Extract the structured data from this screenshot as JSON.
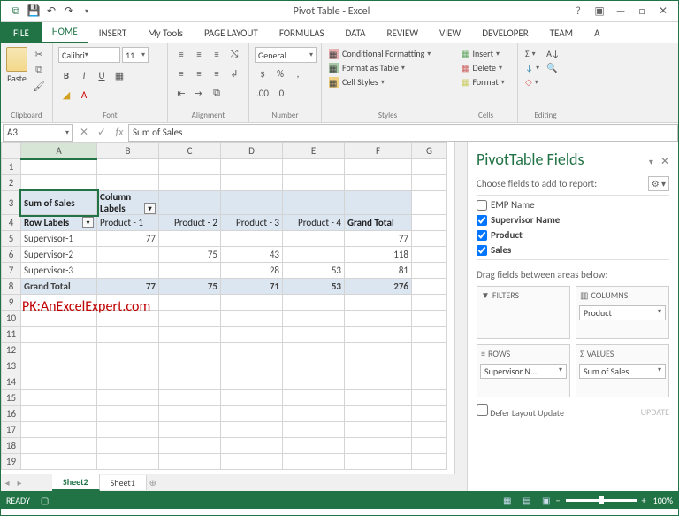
{
  "title": "Pivot Table - Excel",
  "tabs": {
    "file": "FILE",
    "home": "HOME",
    "insert": "INSERT",
    "mytools": "My Tools",
    "page": "PAGE LAYOUT",
    "formulas": "FORMULAS",
    "data": "DATA",
    "review": "REVIEW",
    "view": "VIEW",
    "developer": "DEVELOPER",
    "team": "TEAM",
    "a": "A"
  },
  "ribbon": {
    "paste": "Paste",
    "clipboard": "Clipboard",
    "font_name": "Calibri",
    "font_size": "11",
    "font_group": "Font",
    "alignment": "Alignment",
    "num_format": "General",
    "number_group": "Number",
    "cond_fmt": "Conditional Formatting",
    "fmt_table": "Format as Table",
    "cell_styles": "Cell Styles",
    "styles_group": "Styles",
    "insert": "Insert",
    "delete": "Delete",
    "format": "Format",
    "cells_group": "Cells",
    "editing_group": "Editing"
  },
  "formula": {
    "cell_ref": "A3",
    "fx": "fx",
    "value": "Sum of Sales"
  },
  "columns": [
    "A",
    "B",
    "C",
    "D",
    "E",
    "F",
    "G"
  ],
  "pivot": {
    "a3": "Sum of Sales",
    "b3": "Column Labels",
    "a4": "Row Labels",
    "b4": "Product - 1",
    "c4": "Product - 2",
    "d4": "Product - 3",
    "e4": "Product - 4",
    "f4": "Grand Total",
    "rows": [
      {
        "label": "Supervisor-1",
        "v": [
          "77",
          "",
          "",
          "",
          "77"
        ]
      },
      {
        "label": "Supervisor-2",
        "v": [
          "",
          "75",
          "43",
          "",
          "118"
        ]
      },
      {
        "label": "Supervisor-3",
        "v": [
          "",
          "",
          "28",
          "53",
          "81"
        ]
      }
    ],
    "grand": {
      "label": "Grand Total",
      "v": [
        "77",
        "75",
        "71",
        "53",
        "276"
      ]
    }
  },
  "watermark": "PK:AnExcelExpert.com",
  "sheet_tabs": {
    "s2": "Sheet2",
    "s1": "Sheet1"
  },
  "pane": {
    "title": "PivotTable Fields",
    "choose": "Choose fields to add to report:",
    "fields": [
      {
        "label": "EMP Name",
        "checked": false,
        "bold": false
      },
      {
        "label": "Supervisor Name",
        "checked": true,
        "bold": true
      },
      {
        "label": "Product",
        "checked": true,
        "bold": true
      },
      {
        "label": "Sales",
        "checked": true,
        "bold": true
      }
    ],
    "drag": "Drag fields between areas below:",
    "filters": "FILTERS",
    "columns": "COLUMNS",
    "rows": "ROWS",
    "values": "VALUES",
    "chip_product": "Product",
    "chip_super": "Supervisor N...",
    "chip_sum": "Sum of Sales",
    "defer": "Defer Layout Update",
    "update": "UPDATE"
  },
  "status": {
    "ready": "READY",
    "zoom": "100%"
  },
  "chart_data": {
    "type": "table",
    "title": "Sum of Sales",
    "row_field": "Supervisor Name",
    "column_field": "Product",
    "value_field": "Sum of Sales",
    "columns": [
      "Product - 1",
      "Product - 2",
      "Product - 3",
      "Product - 4"
    ],
    "rows": [
      "Supervisor-1",
      "Supervisor-2",
      "Supervisor-3"
    ],
    "values": [
      [
        77,
        null,
        null,
        null
      ],
      [
        null,
        75,
        43,
        null
      ],
      [
        null,
        null,
        28,
        53
      ]
    ],
    "row_totals": [
      77,
      118,
      81
    ],
    "column_totals": [
      77,
      75,
      71,
      53
    ],
    "grand_total": 276
  }
}
